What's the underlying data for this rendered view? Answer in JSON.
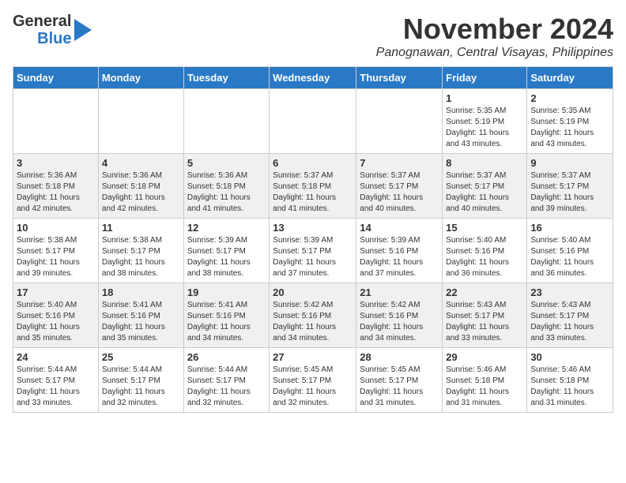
{
  "logo": {
    "line1": "General",
    "line2": "Blue"
  },
  "title": "November 2024",
  "subtitle": "Panognawan, Central Visayas, Philippines",
  "days_of_week": [
    "Sunday",
    "Monday",
    "Tuesday",
    "Wednesday",
    "Thursday",
    "Friday",
    "Saturday"
  ],
  "weeks": [
    [
      {
        "day": "",
        "details": ""
      },
      {
        "day": "",
        "details": ""
      },
      {
        "day": "",
        "details": ""
      },
      {
        "day": "",
        "details": ""
      },
      {
        "day": "",
        "details": ""
      },
      {
        "day": "1",
        "details": "Sunrise: 5:35 AM\nSunset: 5:19 PM\nDaylight: 11 hours\nand 43 minutes."
      },
      {
        "day": "2",
        "details": "Sunrise: 5:35 AM\nSunset: 5:19 PM\nDaylight: 11 hours\nand 43 minutes."
      }
    ],
    [
      {
        "day": "3",
        "details": "Sunrise: 5:36 AM\nSunset: 5:18 PM\nDaylight: 11 hours\nand 42 minutes."
      },
      {
        "day": "4",
        "details": "Sunrise: 5:36 AM\nSunset: 5:18 PM\nDaylight: 11 hours\nand 42 minutes."
      },
      {
        "day": "5",
        "details": "Sunrise: 5:36 AM\nSunset: 5:18 PM\nDaylight: 11 hours\nand 41 minutes."
      },
      {
        "day": "6",
        "details": "Sunrise: 5:37 AM\nSunset: 5:18 PM\nDaylight: 11 hours\nand 41 minutes."
      },
      {
        "day": "7",
        "details": "Sunrise: 5:37 AM\nSunset: 5:17 PM\nDaylight: 11 hours\nand 40 minutes."
      },
      {
        "day": "8",
        "details": "Sunrise: 5:37 AM\nSunset: 5:17 PM\nDaylight: 11 hours\nand 40 minutes."
      },
      {
        "day": "9",
        "details": "Sunrise: 5:37 AM\nSunset: 5:17 PM\nDaylight: 11 hours\nand 39 minutes."
      }
    ],
    [
      {
        "day": "10",
        "details": "Sunrise: 5:38 AM\nSunset: 5:17 PM\nDaylight: 11 hours\nand 39 minutes."
      },
      {
        "day": "11",
        "details": "Sunrise: 5:38 AM\nSunset: 5:17 PM\nDaylight: 11 hours\nand 38 minutes."
      },
      {
        "day": "12",
        "details": "Sunrise: 5:39 AM\nSunset: 5:17 PM\nDaylight: 11 hours\nand 38 minutes."
      },
      {
        "day": "13",
        "details": "Sunrise: 5:39 AM\nSunset: 5:17 PM\nDaylight: 11 hours\nand 37 minutes."
      },
      {
        "day": "14",
        "details": "Sunrise: 5:39 AM\nSunset: 5:16 PM\nDaylight: 11 hours\nand 37 minutes."
      },
      {
        "day": "15",
        "details": "Sunrise: 5:40 AM\nSunset: 5:16 PM\nDaylight: 11 hours\nand 36 minutes."
      },
      {
        "day": "16",
        "details": "Sunrise: 5:40 AM\nSunset: 5:16 PM\nDaylight: 11 hours\nand 36 minutes."
      }
    ],
    [
      {
        "day": "17",
        "details": "Sunrise: 5:40 AM\nSunset: 5:16 PM\nDaylight: 11 hours\nand 35 minutes."
      },
      {
        "day": "18",
        "details": "Sunrise: 5:41 AM\nSunset: 5:16 PM\nDaylight: 11 hours\nand 35 minutes."
      },
      {
        "day": "19",
        "details": "Sunrise: 5:41 AM\nSunset: 5:16 PM\nDaylight: 11 hours\nand 34 minutes."
      },
      {
        "day": "20",
        "details": "Sunrise: 5:42 AM\nSunset: 5:16 PM\nDaylight: 11 hours\nand 34 minutes."
      },
      {
        "day": "21",
        "details": "Sunrise: 5:42 AM\nSunset: 5:16 PM\nDaylight: 11 hours\nand 34 minutes."
      },
      {
        "day": "22",
        "details": "Sunrise: 5:43 AM\nSunset: 5:17 PM\nDaylight: 11 hours\nand 33 minutes."
      },
      {
        "day": "23",
        "details": "Sunrise: 5:43 AM\nSunset: 5:17 PM\nDaylight: 11 hours\nand 33 minutes."
      }
    ],
    [
      {
        "day": "24",
        "details": "Sunrise: 5:44 AM\nSunset: 5:17 PM\nDaylight: 11 hours\nand 33 minutes."
      },
      {
        "day": "25",
        "details": "Sunrise: 5:44 AM\nSunset: 5:17 PM\nDaylight: 11 hours\nand 32 minutes."
      },
      {
        "day": "26",
        "details": "Sunrise: 5:44 AM\nSunset: 5:17 PM\nDaylight: 11 hours\nand 32 minutes."
      },
      {
        "day": "27",
        "details": "Sunrise: 5:45 AM\nSunset: 5:17 PM\nDaylight: 11 hours\nand 32 minutes."
      },
      {
        "day": "28",
        "details": "Sunrise: 5:45 AM\nSunset: 5:17 PM\nDaylight: 11 hours\nand 31 minutes."
      },
      {
        "day": "29",
        "details": "Sunrise: 5:46 AM\nSunset: 5:18 PM\nDaylight: 11 hours\nand 31 minutes."
      },
      {
        "day": "30",
        "details": "Sunrise: 5:46 AM\nSunset: 5:18 PM\nDaylight: 11 hours\nand 31 minutes."
      }
    ]
  ]
}
